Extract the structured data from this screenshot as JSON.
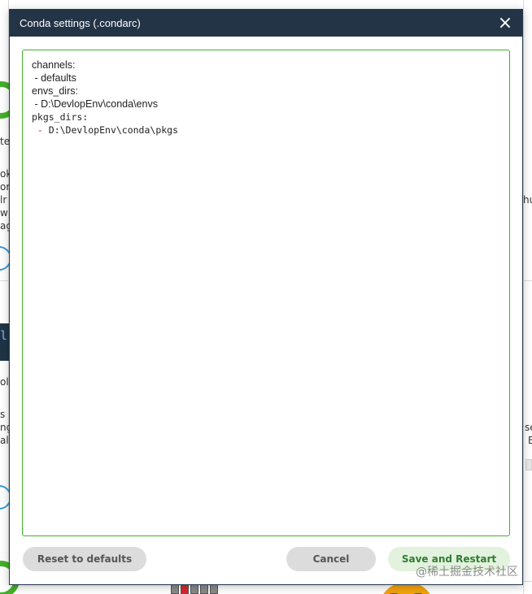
{
  "dialog": {
    "title": "Conda settings (.condarc)",
    "close_icon": "×",
    "editor": {
      "lines": [
        {
          "text": "channels:",
          "dash": "",
          "rest": ""
        },
        {
          "text": "",
          "dash": " - ",
          "rest": "defaults"
        },
        {
          "text": "envs_dirs:",
          "dash": "",
          "rest": ""
        },
        {
          "text": "",
          "dash": " - ",
          "rest": "D:\\DevlopEnv\\conda\\envs"
        },
        {
          "text": "pkgs_dirs:",
          "dash": "",
          "rest": ""
        },
        {
          "text": "",
          "dash": " - ",
          "rest": "D:\\DevlopEnv\\conda\\pkgs"
        }
      ]
    },
    "buttons": {
      "reset": "Reset to defaults",
      "cancel": "Cancel",
      "save": "Save and Restart"
    }
  },
  "background": {
    "frag_left": [
      "te",
      "ok",
      "or",
      "lr",
      "w",
      "ag",
      "l]",
      "ol",
      "s",
      "ng",
      "al"
    ],
    "frag_right": [
      "hu",
      "se",
      "E",
      "f"
    ]
  },
  "watermark": "@稀土掘金技术社区",
  "colors": {
    "titlebar": "#243447",
    "editor_border": "#43b02a",
    "save_text": "#2e7d32",
    "save_bg": "#e3f2de",
    "neutral_button": "#dcdcdc"
  }
}
